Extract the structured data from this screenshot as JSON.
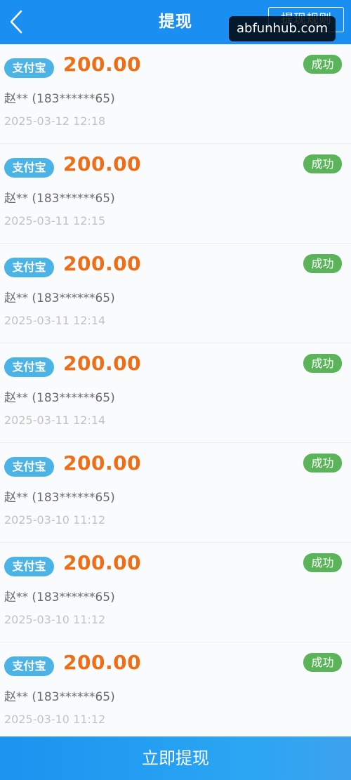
{
  "header": {
    "title": "提现",
    "rules_label": "提现规则",
    "watermark": "abfunhub.com"
  },
  "records": [
    {
      "channel": "支付宝",
      "amount": "200.00",
      "status": "成功",
      "account": "赵** (183******65)",
      "time": "2025-03-12 12:18"
    },
    {
      "channel": "支付宝",
      "amount": "200.00",
      "status": "成功",
      "account": "赵** (183******65)",
      "time": "2025-03-11 12:15"
    },
    {
      "channel": "支付宝",
      "amount": "200.00",
      "status": "成功",
      "account": "赵** (183******65)",
      "time": "2025-03-11 12:14"
    },
    {
      "channel": "支付宝",
      "amount": "200.00",
      "status": "成功",
      "account": "赵** (183******65)",
      "time": "2025-03-11 12:14"
    },
    {
      "channel": "支付宝",
      "amount": "200.00",
      "status": "成功",
      "account": "赵** (183******65)",
      "time": "2025-03-10 11:12"
    },
    {
      "channel": "支付宝",
      "amount": "200.00",
      "status": "成功",
      "account": "赵** (183******65)",
      "time": "2025-03-10 11:12"
    },
    {
      "channel": "支付宝",
      "amount": "200.00",
      "status": "成功",
      "account": "赵** (183******65)",
      "time": "2025-03-10 11:12"
    }
  ],
  "footer": {
    "submit_label": "立即提现"
  },
  "colors": {
    "header_bg": "#1b8ff1",
    "channel_badge": "#4bb3e6",
    "amount": "#ef6d15",
    "status_badge": "#5bb35a"
  }
}
